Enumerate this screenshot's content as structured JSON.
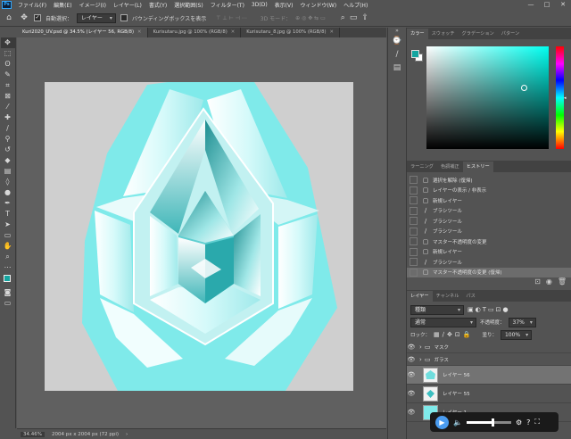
{
  "menu": {
    "logo": "Ps",
    "items": [
      "ファイル(F)",
      "編集(E)",
      "イメージ(I)",
      "レイヤー(L)",
      "書式(Y)",
      "選択範囲(S)",
      "フィルター(T)",
      "3D(D)",
      "表示(V)",
      "ウィンドウ(W)",
      "ヘルプ(H)"
    ]
  },
  "window_controls": [
    "—",
    "□",
    "✕"
  ],
  "options_bar": {
    "auto_select_label": "自動選択：",
    "auto_select_target": "レイヤー",
    "bounding_box_label": "バウンディングボックスを表示",
    "mode_3d": "3D モード："
  },
  "tabs": [
    {
      "title": "Kuri2020_UV.psd @ 34.5% (レイヤー 56, RGB/8)",
      "active": true
    },
    {
      "title": "Kurisutaru.jpg @ 100% (RGB/8)",
      "active": false
    },
    {
      "title": "Kurisutaru_8.jpg @ 100% (RGB/8)",
      "active": false
    }
  ],
  "status": {
    "zoom": "34.46%",
    "doc_size": "2004 px x 2004 px (72 ppi)"
  },
  "color_panel": {
    "tabs": [
      "カラー",
      "スウォッチ",
      "グラデーション",
      "パターン"
    ],
    "foreground": "#14a5a0",
    "background": "#ffffff",
    "hue_color": "#00fff0"
  },
  "history_panel": {
    "tabs": [
      "ラーニング",
      "色調補正",
      "ヒストリー"
    ],
    "items": [
      {
        "label": "選択を解除 (復帰)",
        "icon": "box"
      },
      {
        "label": "レイヤーの表示 / 非表示",
        "icon": "box"
      },
      {
        "label": "新規レイヤー",
        "icon": "box"
      },
      {
        "label": "ブラシツール",
        "icon": "brush"
      },
      {
        "label": "ブラシツール",
        "icon": "brush"
      },
      {
        "label": "ブラシツール",
        "icon": "brush"
      },
      {
        "label": "マスター不透明度の変更",
        "icon": "box"
      },
      {
        "label": "新規レイヤー",
        "icon": "box"
      },
      {
        "label": "ブラシツール",
        "icon": "brush"
      },
      {
        "label": "マスター不透明度の変更 (復帰)",
        "icon": "box",
        "active": true
      }
    ]
  },
  "layers_panel": {
    "tabs": [
      "レイヤー",
      "チャンネル",
      "パス"
    ],
    "filter": "種類",
    "blend_mode": "通常",
    "opacity_label": "不透明度：",
    "opacity_value": "37%",
    "lock_label": "ロック：",
    "fill_label": "塗り：",
    "fill_value": "100%",
    "layers": [
      {
        "name": "マスク",
        "type": "group"
      },
      {
        "name": "ガラス",
        "type": "group"
      },
      {
        "name": "レイヤー 56",
        "type": "layer",
        "selected": true
      },
      {
        "name": "レイヤー 55",
        "type": "layer"
      },
      {
        "name": "レイヤー 1",
        "type": "layer"
      }
    ]
  },
  "media_player": {
    "progress": 0.58
  },
  "artwork": {
    "crystal_color": "#7feaea",
    "canvas_bg": "#cfcfcf"
  }
}
